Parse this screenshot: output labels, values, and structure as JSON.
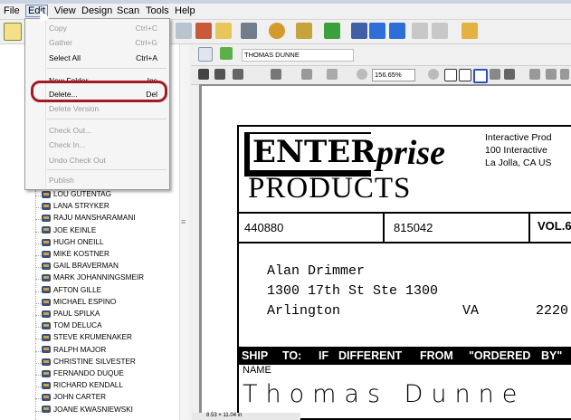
{
  "menubar": {
    "items": [
      "File",
      "Edit",
      "View",
      "Design",
      "Scan",
      "Tools",
      "Help"
    ]
  },
  "edit_menu": {
    "items": [
      {
        "label": "Copy",
        "shortcut": "Ctrl+C",
        "enabled": false
      },
      {
        "label": "Gather",
        "shortcut": "Ctrl+G",
        "enabled": false
      },
      {
        "label": "Select All",
        "shortcut": "Ctrl+A",
        "enabled": true
      },
      {
        "label": "New Folder...",
        "shortcut": "Ins",
        "enabled": true
      },
      {
        "label": "Delete...",
        "shortcut": "Del",
        "enabled": true
      },
      {
        "label": "Delete Version",
        "shortcut": "",
        "enabled": false
      },
      {
        "label": "Check Out...",
        "shortcut": "",
        "enabled": false
      },
      {
        "label": "Check In...",
        "shortcut": "",
        "enabled": false
      },
      {
        "label": "Undo Check Out",
        "shortcut": "",
        "enabled": false
      },
      {
        "label": "Publish",
        "shortcut": "",
        "enabled": false
      }
    ]
  },
  "tree": {
    "items": [
      "LOU GUTENTAG",
      "LANA STRYKER",
      "RAJU MANSHARAMANI",
      "JOE KEINLE",
      "HUGH ONEILL",
      "MIKE KOSTNER",
      "GAIL BRAVERMAN",
      "MARK JOHANNINGSMEIR",
      "AFTON GILLE",
      "MICHAEL ESPINO",
      "PAUL SPILKA",
      "TOM DELUCA",
      "STEVE KRUMENAKER",
      "RALPH MAJOR",
      "CHRISTINE SILVESTER",
      "FERNANDO DUQUE",
      "RICHARD KENDALL",
      "JOHN CARTER",
      "JOANE KWASNIEWSKI"
    ]
  },
  "document": {
    "name": "THOMAS DUNNE",
    "zoom": "156.65%",
    "page_size": "8.53 × 11.04 in"
  },
  "form": {
    "logo_enter": "ENTER",
    "logo_prise": "prise",
    "logo_products": "PRODUCTS",
    "company_line1": "Interactive  Prod",
    "company_line2": "100  Interactive",
    "company_line3": "La Jolla, CA US",
    "field1": "440880",
    "field2": "815042",
    "field3": "VOL.6",
    "addr_name": "Alan Drimmer",
    "addr_street": "1300 17th St Ste 1300",
    "addr_city": "Arlington",
    "addr_state": "VA",
    "addr_zip": "2220",
    "ship_words": [
      "SHIP",
      "TO:",
      "IF",
      "DIFFERENT",
      "FROM",
      "\"ORDERED",
      "BY\""
    ],
    "name_label": "NAME",
    "handwritten_name": "Thomas  Dunne"
  }
}
